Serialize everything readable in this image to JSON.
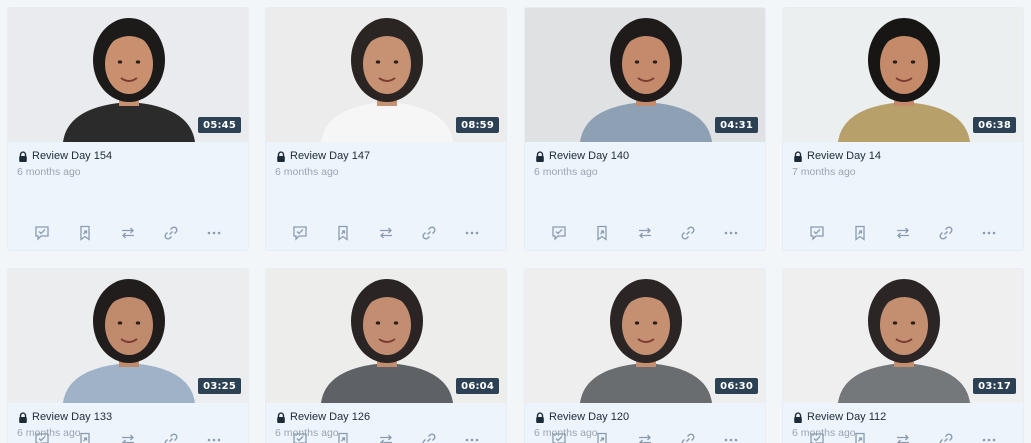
{
  "videos": [
    {
      "title": "Review Day 154",
      "age": "6 months ago",
      "duration": "05:45",
      "bg": "#e9ebee",
      "shirt": "#2b2b2b",
      "skin": "#c8906f",
      "hair": "#1d1a1a"
    },
    {
      "title": "Review Day 147",
      "age": "6 months ago",
      "duration": "08:59",
      "bg": "#ececec",
      "shirt": "#f6f6f6",
      "skin": "#c79173",
      "hair": "#2a2422"
    },
    {
      "title": "Review Day 140",
      "age": "6 months ago",
      "duration": "04:31",
      "bg": "#dfe1e3",
      "shirt": "#8ea1b4",
      "skin": "#c48a6c",
      "hair": "#1f1b1b"
    },
    {
      "title": "Review Day 14",
      "age": "7 months ago",
      "duration": "06:38",
      "bg": "#eceff0",
      "shirt": "#b8a06a",
      "skin": "#c48a69",
      "hair": "#181515"
    },
    {
      "title": "Review Day 133",
      "age": "6 months ago",
      "duration": "03:25",
      "bg": "#ebedee",
      "shirt": "#9fb2c8",
      "skin": "#c08a6d",
      "hair": "#221d1d"
    },
    {
      "title": "Review Day 126",
      "age": "6 months ago",
      "duration": "06:04",
      "bg": "#ededec",
      "shirt": "#5e6266",
      "skin": "#c28d70",
      "hair": "#2a2524"
    },
    {
      "title": "Review Day 120",
      "age": "6 months ago",
      "duration": "06:30",
      "bg": "#eeeeee",
      "shirt": "#6a6d70",
      "skin": "#c58f72",
      "hair": "#2b2625"
    },
    {
      "title": "Review Day 112",
      "age": "6 months ago",
      "duration": "03:17",
      "bg": "#efefef",
      "shirt": "#75787b",
      "skin": "#c48e71",
      "hair": "#2b2625"
    }
  ],
  "actions": {
    "icons": [
      "comment-check-icon",
      "bookmark-share-icon",
      "swap-icon",
      "link-icon",
      "more-icon"
    ]
  },
  "colors": {
    "icon": "#8a9bb0",
    "duration_bg": "#2d4155",
    "title": "#1d2b38",
    "age": "#9aa5b1"
  }
}
